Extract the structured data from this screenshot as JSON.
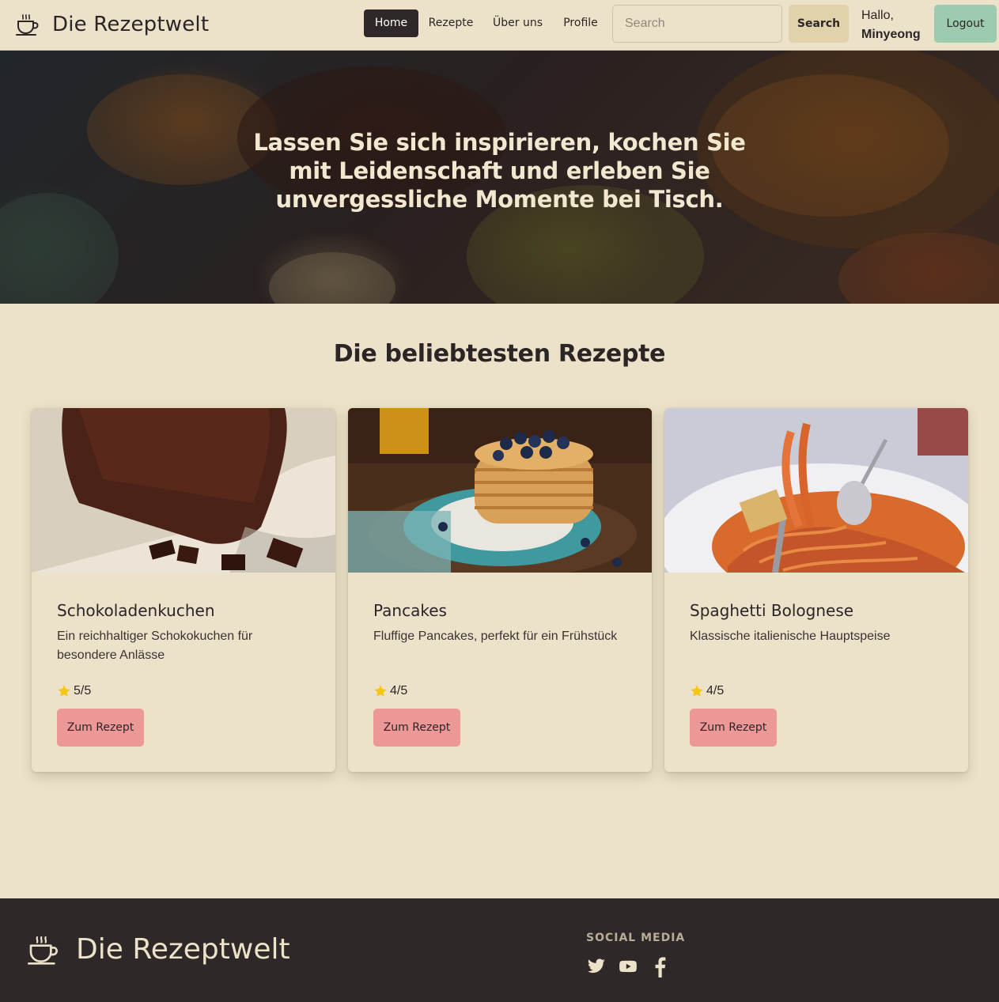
{
  "navbar": {
    "brand": "Die Rezeptwelt",
    "brand_icon": "coffee-cup-icon",
    "links": [
      {
        "label": "Home",
        "active": true
      },
      {
        "label": "Rezepte",
        "active": false
      },
      {
        "label": "Über uns",
        "active": false
      },
      {
        "label": "Profile",
        "active": false
      }
    ],
    "search_placeholder": "Search",
    "search_value": "",
    "search_button": "Search",
    "greeting": "Hallo,",
    "username": "Minyeong",
    "logout": "Logout"
  },
  "hero": {
    "text": "Lassen Sie sich inspirieren, kochen Sie mit Leidenschaft und erleben Sie unvergessliche Momente bei Tisch."
  },
  "section": {
    "title": "Die beliebtesten Rezepte"
  },
  "cards": [
    {
      "title": "Schokoladenkuchen",
      "description": "Ein reichhaltiger Schokokuchen für besondere Anlässe",
      "rating": "5/5",
      "button": "Zum Rezept",
      "image": "chocolate-cake-photo"
    },
    {
      "title": "Pancakes",
      "description": "Fluffige Pancakes, perfekt für ein Frühstück",
      "rating": "4/5",
      "button": "Zum Rezept",
      "image": "pancakes-photo"
    },
    {
      "title": "Spaghetti Bolognese",
      "description": "Klassische italienische Hauptspeise",
      "rating": "4/5",
      "button": "Zum Rezept",
      "image": "spaghetti-photo"
    }
  ],
  "footer": {
    "brand": "Die Rezeptwelt",
    "social_heading": "SOCIAL MEDIA",
    "social_icons": [
      "twitter-icon",
      "youtube-icon",
      "facebook-icon"
    ]
  },
  "colors": {
    "background": "#ece2c9",
    "dark": "#2e2829",
    "accent_button": "#ec9896",
    "logout_button": "#9ccbb0",
    "search_button": "#e0d2aa",
    "star": "#f5c518"
  }
}
